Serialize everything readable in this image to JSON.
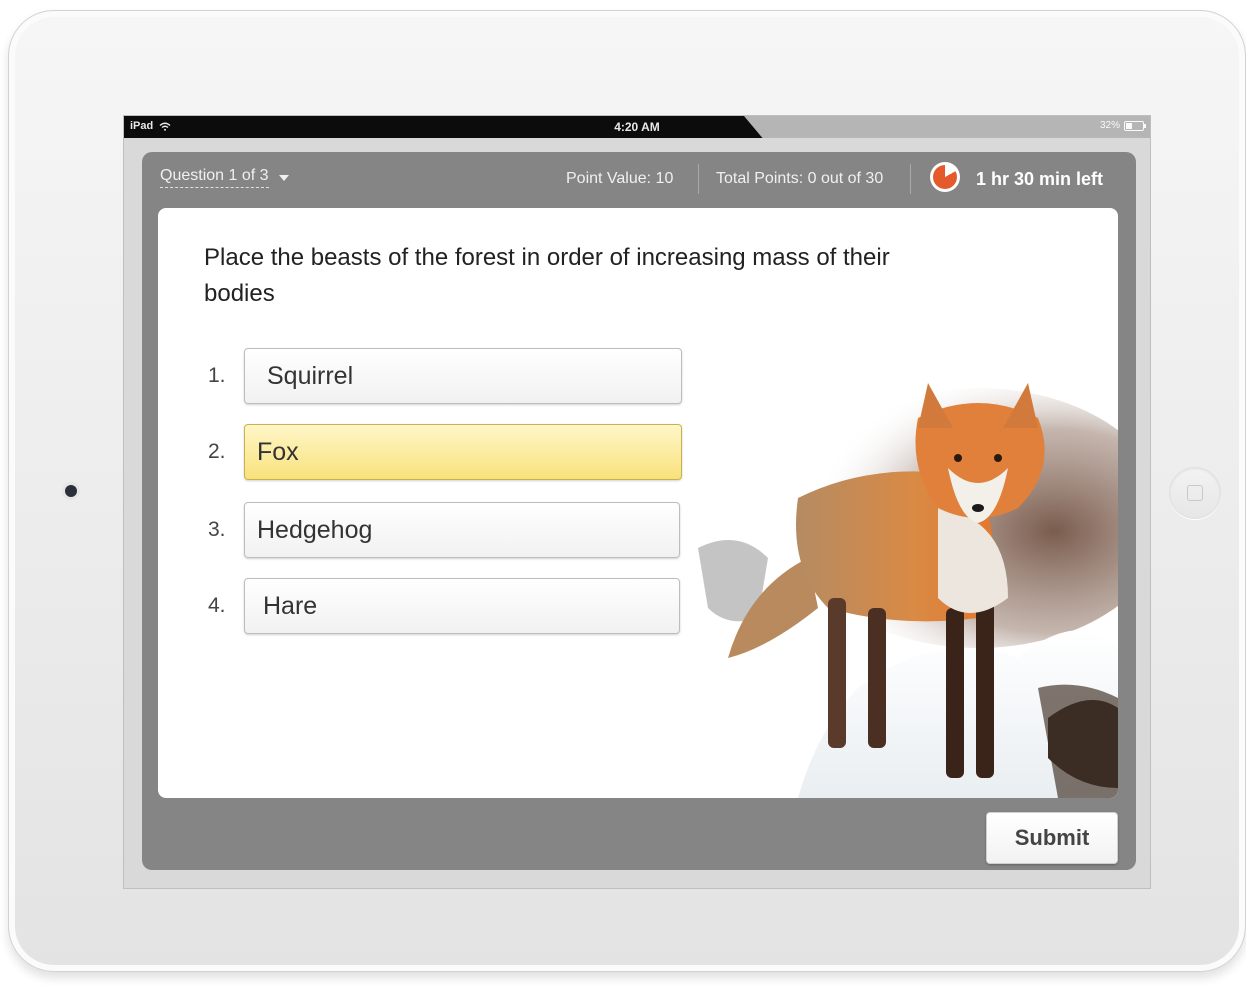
{
  "status_bar": {
    "device": "iPad",
    "time": "4:20 AM",
    "battery": "32%"
  },
  "header": {
    "question_selector": "Question 1 of 3",
    "point_value": "Point Value: 10",
    "total_points": "Total Points: 0 out of 30",
    "time_left": "1 hr 30 min left",
    "timer_elapsed_fraction": 0.17
  },
  "question": {
    "text": "Place the beasts of the forest in order of increasing mass of their bodies"
  },
  "answers": [
    {
      "number": "1.",
      "label": "Squirrel",
      "active": false
    },
    {
      "number": "2.",
      "label": "Fox",
      "active": true
    },
    {
      "number": "3.",
      "label": "Hedgehog",
      "active": false
    },
    {
      "number": "4.",
      "label": "Hare",
      "active": false
    }
  ],
  "actions": {
    "submit_label": "Submit"
  },
  "colors": {
    "accent_timer": "#e55a2b",
    "active_answer": "#f8e27c",
    "toolbar": "#858585"
  }
}
